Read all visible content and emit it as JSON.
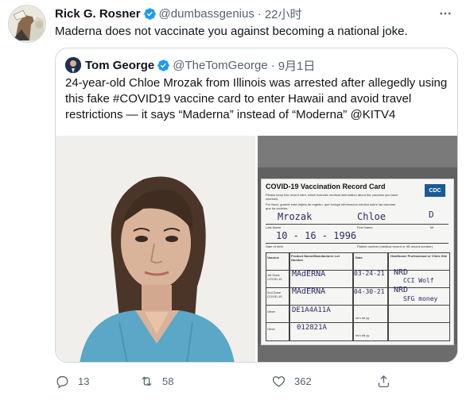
{
  "tweet": {
    "author_name": "Rick G. Rosner",
    "author_handle": "@dumbassgenius",
    "separator": "·",
    "time": "22小时",
    "text": "Maderna does not vaccinate you against becoming a national joke.",
    "more_icon": "more-horizontal-icon"
  },
  "quoted": {
    "author_name": "Tom George",
    "author_handle": "@TheTomGeorge",
    "separator": "·",
    "time": "9月1日",
    "text": "24-year-old Chloe Mrozak from Illinois was arrested after allegedly using this fake #COVID19 vaccine card to enter Hawaii and avoid travel restrictions — it says “Maderna” instead of “Moderna” @KITV4",
    "card": {
      "title": "COVID-19 Vaccination Record Card",
      "info_en": "Please keep this record card, which includes medical information about the vaccines you have received.",
      "info_es": "Por favor, guarde esta tarjeta de registro, que incluye información médica sobre las vacunas que ha recibido.",
      "badge": "CDC",
      "last_name": "Mrozak",
      "first_name": "Chloe",
      "mi": "D",
      "label_last": "Last Name",
      "label_first": "First Name",
      "label_mi": "MI",
      "dob": "10 - 16 - 1996",
      "label_dob": "Date of birth",
      "label_patient": "Patient number (medical record or IIS record number)",
      "col_vaccine": "Vaccine",
      "col_product": "Product Name/Manufacturer Lot Number",
      "col_date": "Date",
      "col_site": "Healthcare Professional or Clinic Site",
      "row1_label": "1st Dose COVID-19",
      "row2_label": "2nd Dose COVID-19",
      "row3_label": "Other",
      "row4_label": "Other",
      "row1_product": "MAdERNA",
      "row1_date": "03-24-21",
      "row1_site": "NRD",
      "row2_product": "MAdERNA",
      "row2_date": "04-30-21",
      "row2_site": "NRD",
      "row3_product": "DE1A4A11A",
      "row4_product": "012821A",
      "signature": "CCI Wolf",
      "signature2": "SFG money",
      "date_placeholder": "mm dd yy"
    }
  },
  "actions": {
    "reply_count": "13",
    "retweet_count": "58",
    "like_count": "362",
    "reply_icon": "reply-icon",
    "retweet_icon": "retweet-icon",
    "like_icon": "heart-icon",
    "share_icon": "share-icon"
  },
  "colors": {
    "text": "#0f1419",
    "secondary": "#536471",
    "verified": "#1d9bf0",
    "border": "#cfd9de"
  }
}
